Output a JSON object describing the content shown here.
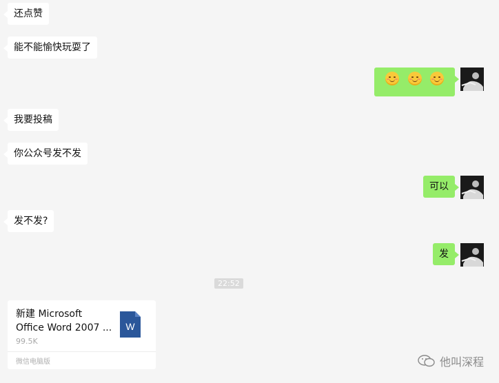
{
  "messages": {
    "m1": "还点赞",
    "m2": "能不能愉快玩耍了",
    "m4": "我要投稿",
    "m5": "你公众号发不发",
    "m6": "可以",
    "m7": "发不发?",
    "m8": "发"
  },
  "outgoing_emojis": [
    "smiling-face",
    "smiling-face",
    "smiling-face"
  ],
  "timestamp": "22:52",
  "file": {
    "name": "新建 Microsoft Office Word 2007 ...",
    "size": "99.5K",
    "source": "微信电脑版",
    "icon_letter": "W"
  },
  "watermark": "他叫深程",
  "colors": {
    "background": "#f5f5f5",
    "outgoing_bubble": "#95ec69",
    "incoming_bubble": "#ffffff",
    "word_blue": "#2b579a"
  }
}
